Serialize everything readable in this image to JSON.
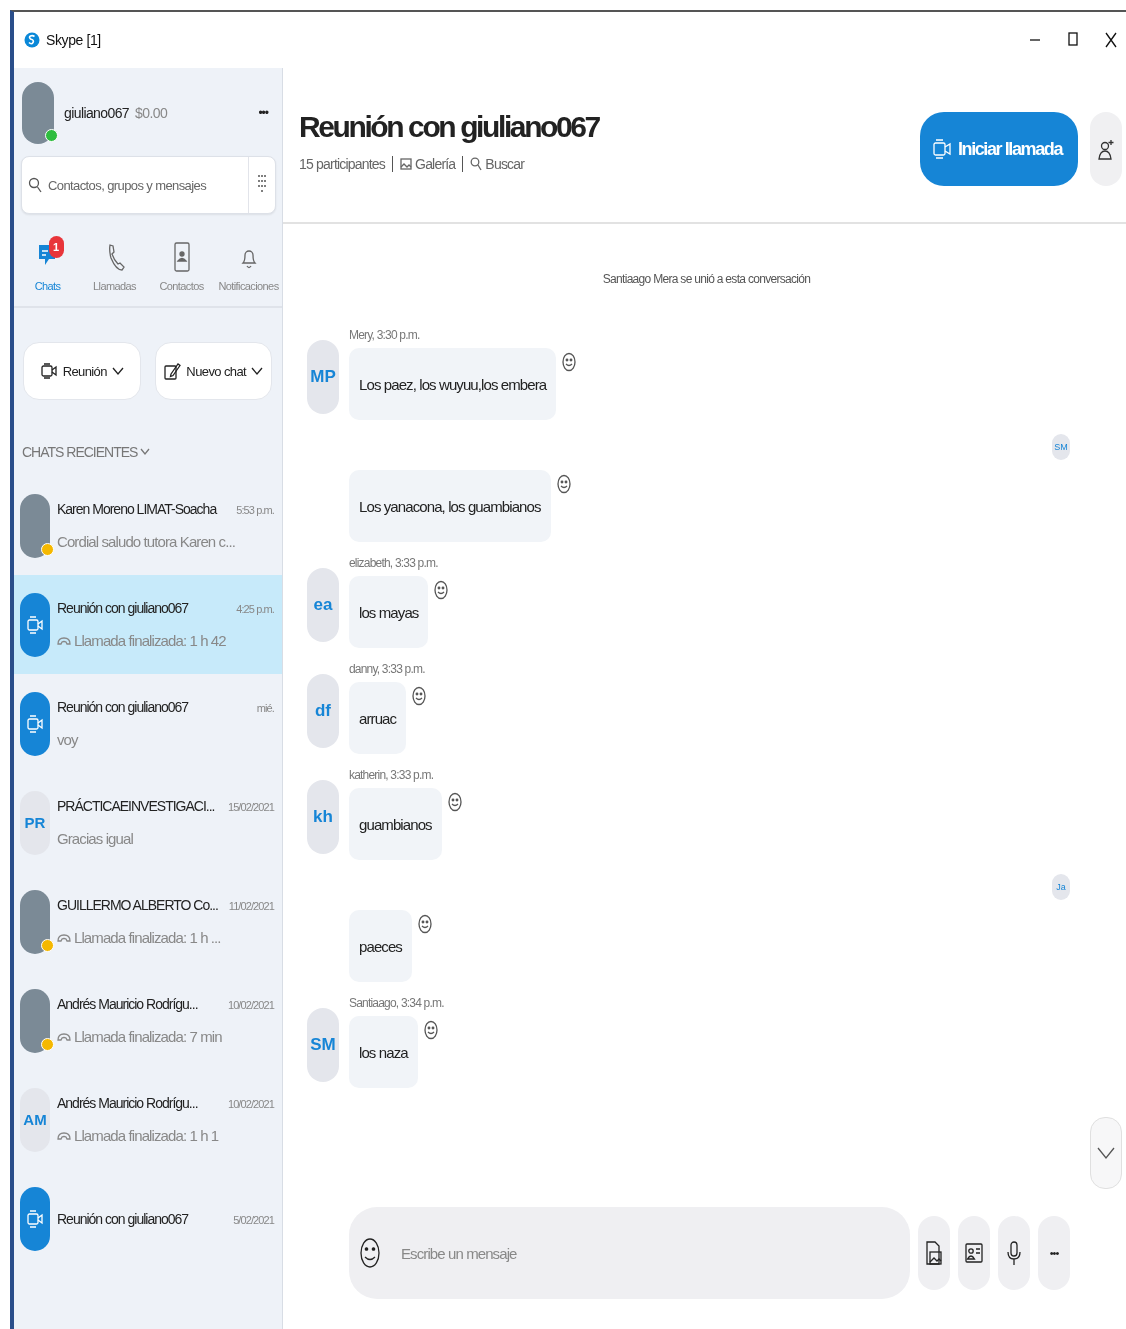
{
  "window": {
    "title": "Skype [1]"
  },
  "profile": {
    "name": "giuliano067",
    "balance": "$0.00",
    "color": "#2ebd3f",
    "menu": "•••"
  },
  "search": {
    "placeholder": "Contactos, grupos y mensajes"
  },
  "nav": [
    {
      "label": "Chats",
      "kind": "chat",
      "selected": true,
      "badge": "1"
    },
    {
      "label": "Llamadas",
      "kind": "phone",
      "selected": false
    },
    {
      "label": "Contactos",
      "kind": "contacts",
      "selected": false
    },
    {
      "label": "Notificaciones",
      "kind": "bell",
      "selected": false
    }
  ],
  "actions": [
    {
      "label": "Reunión",
      "kind": "video"
    },
    {
      "label": "Nuevo chat",
      "kind": "compose"
    }
  ],
  "recent_header": "CHATS RECIENTES",
  "chats": [
    {
      "name": "Karen Moreno LIMAT-Soacha",
      "time": "5:53 p.m.",
      "preview": "Cordial saludo tutora Karen c...",
      "kind": "photo",
      "color": "#f5b800",
      "call": false,
      "selected": false
    },
    {
      "name": "Reunión con giuliano067",
      "time": "4:25 p.m.",
      "preview": "Llamada finalizada: 1 h 42",
      "kind": "meeting",
      "call": true,
      "selected": true
    },
    {
      "name": "Reunión con giuliano067",
      "time": "mié.",
      "preview": "voy",
      "kind": "meeting",
      "call": false,
      "selected": false
    },
    {
      "name": "PRÁCTICAEINVESTIGACI...",
      "time": "15/02/2021",
      "preview": "Gracias igual",
      "kind": "initials",
      "initials": "PR",
      "call": false,
      "selected": false
    },
    {
      "name": "GUILLERMO ALBERTO Co...",
      "time": "11/02/2021",
      "preview": "Llamada finalizada: 1 h ...",
      "kind": "photo",
      "color": "#f5b800",
      "call": true,
      "selected": false
    },
    {
      "name": "Andrés  Mauricio Rodrígu...",
      "time": "10/02/2021",
      "preview": "Llamada finalizada: 7 min",
      "kind": "photo",
      "color": "#f5b800",
      "call": true,
      "selected": false
    },
    {
      "name": "Andrés  Mauricio Rodrígu...",
      "time": "10/02/2021",
      "preview": "Llamada finalizada: 1 h 1",
      "kind": "initials",
      "initials": "AM",
      "call": true,
      "selected": false
    },
    {
      "name": "Reunión con giuliano067",
      "time": "5/02/2021",
      "kind": "meeting",
      "selected": false
    }
  ],
  "conversation": {
    "title": "Reunión con giuliano067",
    "participants": "15 participantes",
    "gallery": "Galería",
    "search": "Buscar",
    "call_button": "Iniciar llamada"
  },
  "messages": [
    {
      "kind": "system",
      "text": "Santiaago Mera se unió a esta conversación"
    },
    {
      "kind": "message",
      "initials": "MP",
      "meta": "Mery, 3:30 p.m.",
      "text": "Los paez, los wuyuu,los embera"
    },
    {
      "kind": "receipt",
      "initials": "SM"
    },
    {
      "kind": "message",
      "text": "Los yanacona, los guambianos"
    },
    {
      "kind": "message",
      "initials": "ea",
      "meta": "elizabeth, 3:33 p.m.",
      "text": "los mayas"
    },
    {
      "kind": "message",
      "initials": "df",
      "meta": "danny, 3:33 p.m.",
      "text": "arruac"
    },
    {
      "kind": "message",
      "initials": "kh",
      "meta": "katherin, 3:33 p.m.",
      "text": "guambianos"
    },
    {
      "kind": "receipt",
      "initials": "Ja"
    },
    {
      "kind": "message",
      "text": "paeces"
    },
    {
      "kind": "message",
      "initials": "SM",
      "meta": "Santiaago, 3:34 p.m.",
      "text": "los naza"
    }
  ],
  "composer": {
    "placeholder": "Escribe un mensaje",
    "more": "•••"
  }
}
